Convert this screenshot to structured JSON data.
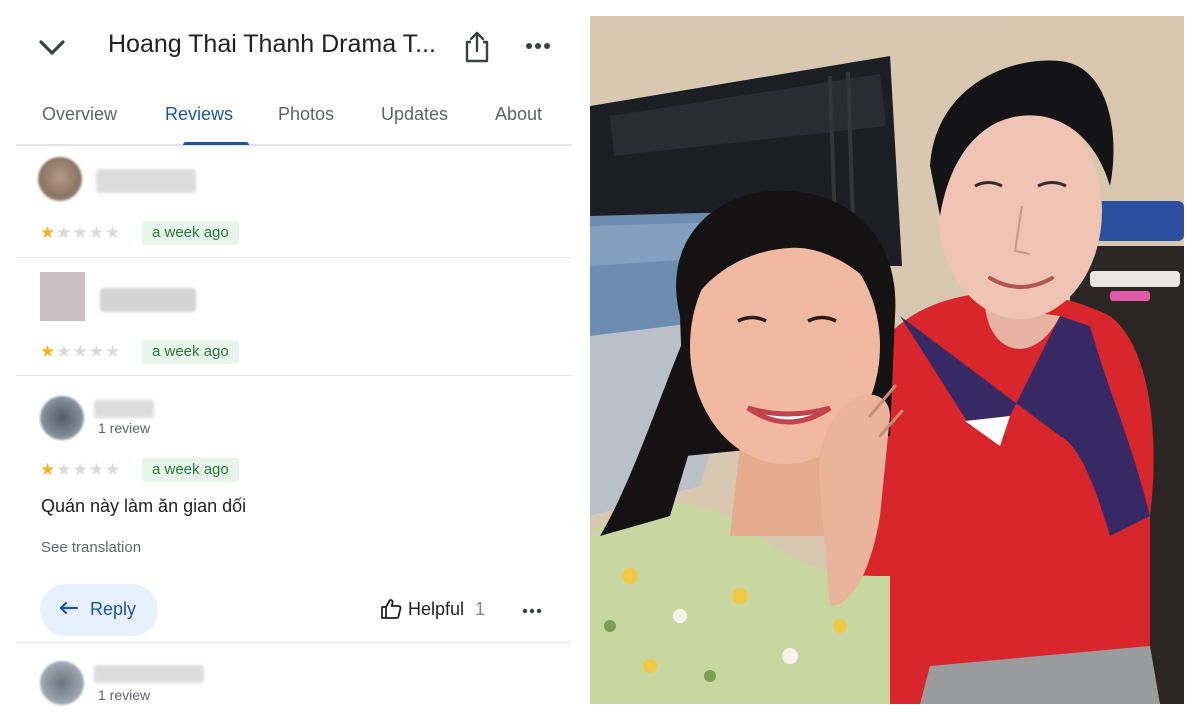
{
  "header": {
    "title": "Hoang Thai Thanh Drama T...",
    "back_icon": "chevron-down-icon",
    "share_icon": "share-icon",
    "more_icon": "more-horiz-icon"
  },
  "tabs": [
    {
      "label": "Overview"
    },
    {
      "label": "Reviews",
      "active": true
    },
    {
      "label": "Photos"
    },
    {
      "label": "Updates"
    },
    {
      "label": "About"
    }
  ],
  "reviews": [
    {
      "rating": 1,
      "max_rating": 5,
      "date": "a week ago"
    },
    {
      "rating": 1,
      "max_rating": 5,
      "date": "a week ago"
    },
    {
      "rating": 1,
      "max_rating": 5,
      "date": "a week ago",
      "meta": "1 review",
      "text": "Quán này làm ăn gian dối",
      "see_translation": "See translation",
      "reply_label": "Reply",
      "helpful_label": "Helpful",
      "helpful_count": "1"
    },
    {
      "meta": "1 review"
    }
  ],
  "colors": {
    "accent": "#1a55a8",
    "star": "#f3b41b",
    "date_badge_bg": "#e6f4ea",
    "date_badge_text": "#2a7a3f"
  }
}
